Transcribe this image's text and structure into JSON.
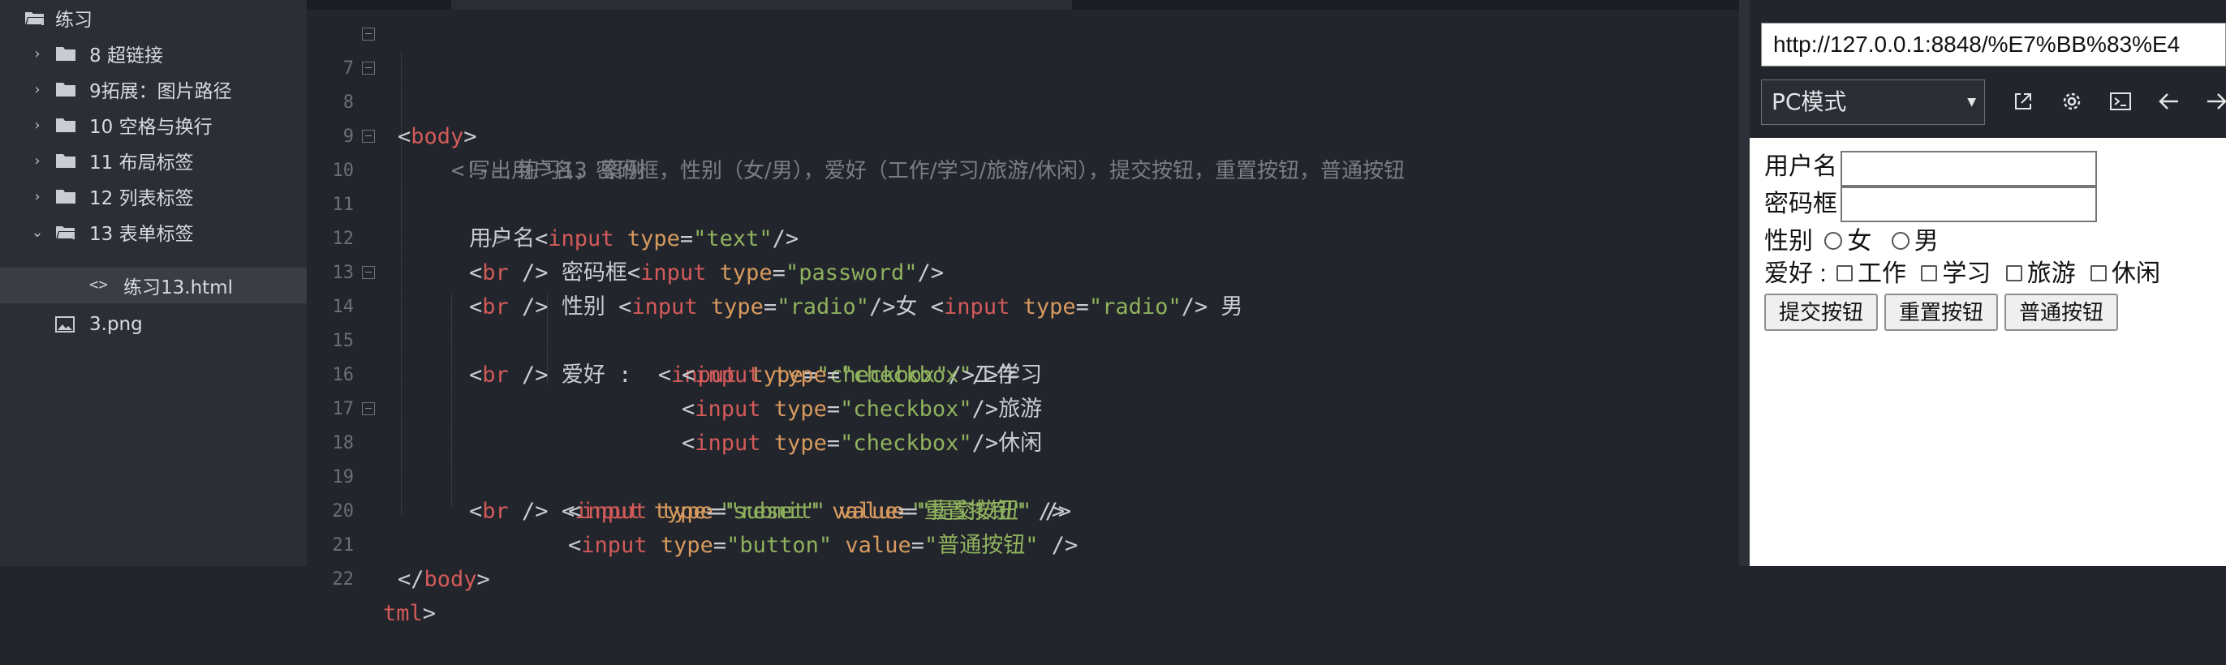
{
  "sidebar": {
    "root": {
      "label": "练习",
      "icon": "folder-open-icon"
    },
    "items": [
      {
        "label": "8 超链接",
        "type": "folder"
      },
      {
        "label": "9拓展：图片路径",
        "type": "folder"
      },
      {
        "label": "10 空格与换行",
        "type": "folder"
      },
      {
        "label": "11 布局标签",
        "type": "folder"
      },
      {
        "label": "12 列表标签",
        "type": "folder"
      },
      {
        "label": "13 表单标签",
        "type": "folder",
        "expanded": true
      },
      {
        "label": "练习13.html",
        "type": "html-file",
        "active": true
      },
      {
        "label": "3.png",
        "type": "image-file"
      }
    ]
  },
  "editor": {
    "lines": [
      {
        "num": "7",
        "fold": true
      },
      {
        "num": "8",
        "fold": true
      },
      {
        "num": "9",
        "fold": false
      },
      {
        "num": "10",
        "fold": true
      },
      {
        "num": "11",
        "fold": false
      },
      {
        "num": "12",
        "fold": false
      },
      {
        "num": "13",
        "fold": false
      },
      {
        "num": "14",
        "fold": true
      },
      {
        "num": "15",
        "fold": false
      },
      {
        "num": "16",
        "fold": false
      },
      {
        "num": "17",
        "fold": false
      },
      {
        "num": "18",
        "fold": true
      },
      {
        "num": "19",
        "fold": false
      },
      {
        "num": "20",
        "fold": false
      },
      {
        "num": "21",
        "fold": false
      },
      {
        "num": "22",
        "fold": false
      }
    ],
    "code": {
      "l7_tag": "body",
      "l8_comment": "<!-- 练习13 案例",
      "l9_comment": "写出用户名，密码框，性别（女/男），爱好（工作/学习/旅游/休闲），提交按钮，重置按钮，普通按钮",
      "l10_comment": "-->",
      "l11_text": "用户名",
      "l12_text": "密码框",
      "l13_text": "性别 ",
      "l13_female": "女 ",
      "l13_male": " 男",
      "l14_text": "爱好 :  ",
      "l14_hobby": "工作",
      "l15_hobby": "学习",
      "l16_hobby": "旅游",
      "l17_hobby": "休闲",
      "l18_value": "\"提交按钮\"",
      "l19_value": "\"重置按钮\"",
      "l20_value": "\"普通按钮\"",
      "l22_text": "tml"
    }
  },
  "preview": {
    "url": "http://127.0.0.1:8848/%E7%BB%83%E4",
    "mode": "PC模式",
    "toolbar_icons": [
      "external-link-icon",
      "gear-icon",
      "terminal-icon",
      "back-arrow-icon",
      "forward-arrow-icon"
    ],
    "form": {
      "username_label": "用户名",
      "password_label": "密码框",
      "gender_label": "性别",
      "female": "女",
      "male": "男",
      "hobby_label": "爱好 :",
      "hobbies": [
        "工作",
        "学习",
        "旅游",
        "休闲"
      ],
      "submit": "提交按钮",
      "reset": "重置按钮",
      "button": "普通按钮"
    }
  },
  "colors": {
    "tag": "#d35a5a",
    "attr": "#d79a5f",
    "string": "#8fb25e",
    "comment": "#7a7e87",
    "bg": "#22252b"
  }
}
